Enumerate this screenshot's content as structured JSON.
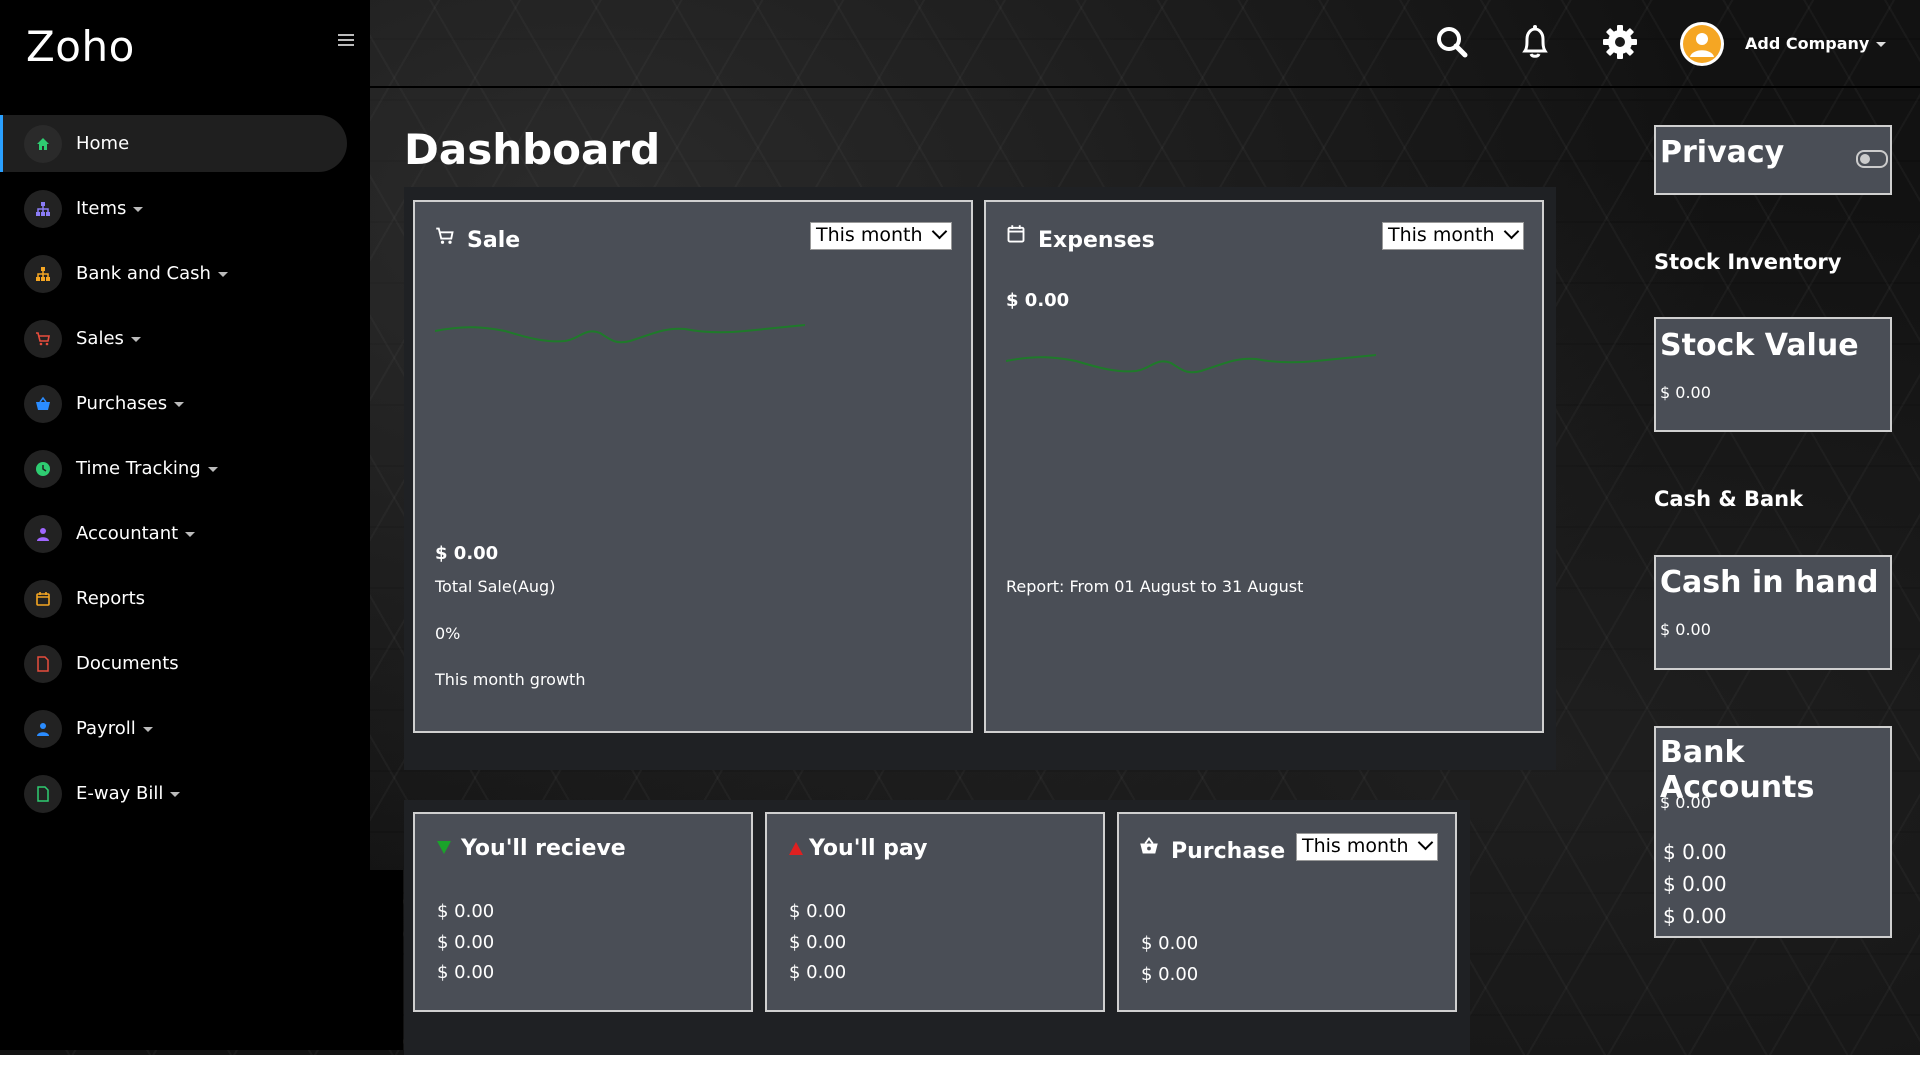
{
  "app": {
    "brand": "Zoho"
  },
  "header": {
    "company_label": "Add Company"
  },
  "sidebar": {
    "items": [
      {
        "label": "Home",
        "icon": "home-icon",
        "color": "#2ecc71",
        "has_caret": false
      },
      {
        "label": "Items",
        "icon": "sitemap-icon",
        "color": "#8b7cf6",
        "has_caret": true
      },
      {
        "label": "Bank and Cash",
        "icon": "sitemap-icon",
        "color": "#f5a623",
        "has_caret": true
      },
      {
        "label": "Sales",
        "icon": "cart-icon",
        "color": "#e74c3c",
        "has_caret": true
      },
      {
        "label": "Purchases",
        "icon": "basket-icon",
        "color": "#2a8cff",
        "has_caret": true
      },
      {
        "label": "Time Tracking",
        "icon": "clock-icon",
        "color": "#2ecc71",
        "has_caret": true
      },
      {
        "label": "Accountant",
        "icon": "user-icon",
        "color": "#a066ff",
        "has_caret": true
      },
      {
        "label": "Reports",
        "icon": "calendar-icon",
        "color": "#f5a623",
        "has_caret": false
      },
      {
        "label": "Documents",
        "icon": "document-icon",
        "color": "#e74c3c",
        "has_caret": false
      },
      {
        "label": "Payroll",
        "icon": "user-icon",
        "color": "#2a8cff",
        "has_caret": true
      },
      {
        "label": "E-way Bill",
        "icon": "document-icon",
        "color": "#2ecc71",
        "has_caret": true
      }
    ]
  },
  "main": {
    "title": "Dashboard",
    "sale": {
      "title": "Sale",
      "period": "This month",
      "amount": "$ 0.00",
      "total_label": "Total Sale(Aug)",
      "growth": "0%",
      "growth_label": "This month growth"
    },
    "expenses": {
      "title": "Expenses",
      "period": "This month",
      "amount": "$ 0.00",
      "report": "Report: From 01 August to 31 August"
    },
    "receive": {
      "title": "You'll recieve",
      "values": [
        "$ 0.00",
        "$ 0.00",
        "$ 0.00"
      ]
    },
    "pay": {
      "title": "You'll pay",
      "values": [
        "$ 0.00",
        "$ 0.00",
        "$ 0.00"
      ]
    },
    "purchase": {
      "title": "Purchase",
      "period": "This month",
      "values": [
        "$ 0.00",
        "$ 0.00"
      ]
    }
  },
  "right": {
    "privacy_title": "Privacy",
    "stock_section": "Stock Inventory",
    "stock_title": "Stock Value",
    "stock_value": "$ 0.00",
    "cash_section": "Cash & Bank",
    "cash_title": "Cash in hand",
    "cash_value": "$ 0.00",
    "bank_title": "Bank Accounts",
    "bank_total": "$ 0.00",
    "bank_values": [
      "$ 0.00",
      "$ 0.00",
      "$ 0.00"
    ]
  },
  "colors": {
    "accent": "#2aa0ff",
    "sparkline": "#1f7a2a",
    "card": "#4a4e56",
    "panel": "#1f2124",
    "receive_arrow": "#1aa32a",
    "pay_arrow": "#e02020"
  }
}
